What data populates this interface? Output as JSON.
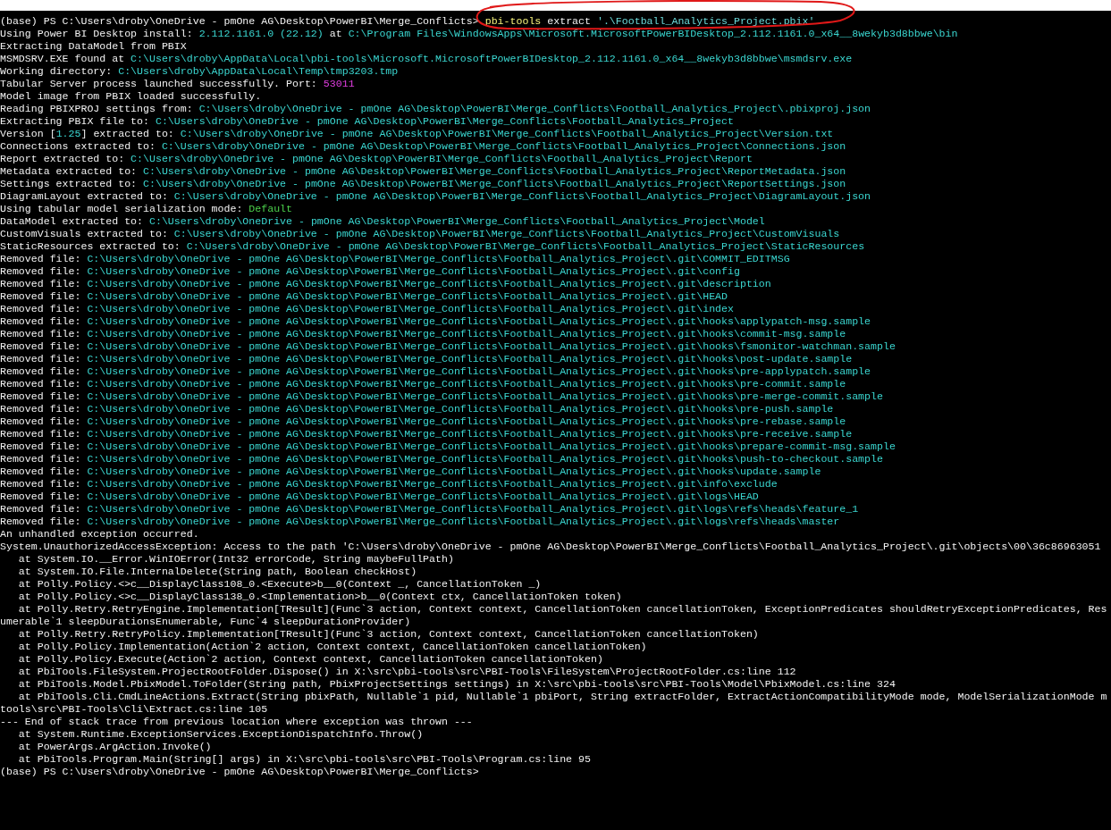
{
  "terminal": {
    "lines": [
      [
        {
          "kind": "plain",
          "text": "(base) PS C:\\Users\\droby\\OneDrive - pmOne AG\\Desktop\\PowerBI\\Merge_Conflicts> "
        },
        {
          "kind": "command",
          "text": "pbi-tools"
        },
        {
          "kind": "plain",
          "text": " extract "
        },
        {
          "kind": "string",
          "text": "'.\\Football_Analytics_Project.pbix'"
        }
      ],
      [
        {
          "kind": "plain",
          "text": "Using Power BI Desktop install: "
        },
        {
          "kind": "path",
          "text": "2.112.1161.0 (22.12)"
        },
        {
          "kind": "plain",
          "text": " at "
        },
        {
          "kind": "path",
          "text": "C:\\Program Files\\WindowsApps\\Microsoft.MicrosoftPowerBIDesktop_2.112.1161.0_x64__8wekyb3d8bbwe\\bin"
        }
      ],
      [
        {
          "kind": "plain",
          "text": "Extracting DataModel from PBIX"
        }
      ],
      [
        {
          "kind": "plain",
          "text": "MSMDSRV.EXE found at "
        },
        {
          "kind": "path",
          "text": "C:\\Users\\droby\\AppData\\Local\\pbi-tools\\Microsoft.MicrosoftPowerBIDesktop_2.112.1161.0_x64__8wekyb3d8bbwe\\msmdsrv.exe"
        }
      ],
      [
        {
          "kind": "plain",
          "text": "Working directory: "
        },
        {
          "kind": "path",
          "text": "C:\\Users\\droby\\AppData\\Local\\Temp\\tmp3203.tmp"
        }
      ],
      [
        {
          "kind": "plain",
          "text": "Tabular Server process launched successfully. Port: "
        },
        {
          "kind": "port",
          "text": "53011"
        }
      ],
      [
        {
          "kind": "plain",
          "text": "Model image from PBIX loaded successfully."
        }
      ],
      [
        {
          "kind": "plain",
          "text": "Reading PBIXPROJ settings from: "
        },
        {
          "kind": "path",
          "text": "C:\\Users\\droby\\OneDrive - pmOne AG\\Desktop\\PowerBI\\Merge_Conflicts\\Football_Analytics_Project\\.pbixproj.json"
        }
      ],
      [
        {
          "kind": "plain",
          "text": "Extracting PBIX file to: "
        },
        {
          "kind": "path",
          "text": "C:\\Users\\droby\\OneDrive - pmOne AG\\Desktop\\PowerBI\\Merge_Conflicts\\Football_Analytics_Project"
        }
      ],
      [
        {
          "kind": "plain",
          "text": "Version ["
        },
        {
          "kind": "path",
          "text": "1.25"
        },
        {
          "kind": "plain",
          "text": "] extracted to: "
        },
        {
          "kind": "path",
          "text": "C:\\Users\\droby\\OneDrive - pmOne AG\\Desktop\\PowerBI\\Merge_Conflicts\\Football_Analytics_Project\\Version.txt"
        }
      ],
      [
        {
          "kind": "plain",
          "text": "Connections extracted to: "
        },
        {
          "kind": "path",
          "text": "C:\\Users\\droby\\OneDrive - pmOne AG\\Desktop\\PowerBI\\Merge_Conflicts\\Football_Analytics_Project\\Connections.json"
        }
      ],
      [
        {
          "kind": "plain",
          "text": "Report extracted to: "
        },
        {
          "kind": "path",
          "text": "C:\\Users\\droby\\OneDrive - pmOne AG\\Desktop\\PowerBI\\Merge_Conflicts\\Football_Analytics_Project\\Report"
        }
      ],
      [
        {
          "kind": "plain",
          "text": "Metadata extracted to: "
        },
        {
          "kind": "path",
          "text": "C:\\Users\\droby\\OneDrive - pmOne AG\\Desktop\\PowerBI\\Merge_Conflicts\\Football_Analytics_Project\\ReportMetadata.json"
        }
      ],
      [
        {
          "kind": "plain",
          "text": "Settings extracted to: "
        },
        {
          "kind": "path",
          "text": "C:\\Users\\droby\\OneDrive - pmOne AG\\Desktop\\PowerBI\\Merge_Conflicts\\Football_Analytics_Project\\ReportSettings.json"
        }
      ],
      [
        {
          "kind": "plain",
          "text": "DiagramLayout extracted to: "
        },
        {
          "kind": "path",
          "text": "C:\\Users\\droby\\OneDrive - pmOne AG\\Desktop\\PowerBI\\Merge_Conflicts\\Football_Analytics_Project\\DiagramLayout.json"
        }
      ],
      [
        {
          "kind": "plain",
          "text": "Using tabular model serialization mode: "
        },
        {
          "kind": "value",
          "text": "Default"
        }
      ],
      [
        {
          "kind": "plain",
          "text": "DataModel extracted to: "
        },
        {
          "kind": "path",
          "text": "C:\\Users\\droby\\OneDrive - pmOne AG\\Desktop\\PowerBI\\Merge_Conflicts\\Football_Analytics_Project\\Model"
        }
      ],
      [
        {
          "kind": "plain",
          "text": "CustomVisuals extracted to: "
        },
        {
          "kind": "path",
          "text": "C:\\Users\\droby\\OneDrive - pmOne AG\\Desktop\\PowerBI\\Merge_Conflicts\\Football_Analytics_Project\\CustomVisuals"
        }
      ],
      [
        {
          "kind": "plain",
          "text": "StaticResources extracted to: "
        },
        {
          "kind": "path",
          "text": "C:\\Users\\droby\\OneDrive - pmOne AG\\Desktop\\PowerBI\\Merge_Conflicts\\Football_Analytics_Project\\StaticResources"
        }
      ],
      [
        {
          "kind": "plain",
          "text": "Removed file: "
        },
        {
          "kind": "path",
          "text": "C:\\Users\\droby\\OneDrive - pmOne AG\\Desktop\\PowerBI\\Merge_Conflicts\\Football_Analytics_Project\\.git\\COMMIT_EDITMSG"
        }
      ],
      [
        {
          "kind": "plain",
          "text": "Removed file: "
        },
        {
          "kind": "path",
          "text": "C:\\Users\\droby\\OneDrive - pmOne AG\\Desktop\\PowerBI\\Merge_Conflicts\\Football_Analytics_Project\\.git\\config"
        }
      ],
      [
        {
          "kind": "plain",
          "text": "Removed file: "
        },
        {
          "kind": "path",
          "text": "C:\\Users\\droby\\OneDrive - pmOne AG\\Desktop\\PowerBI\\Merge_Conflicts\\Football_Analytics_Project\\.git\\description"
        }
      ],
      [
        {
          "kind": "plain",
          "text": "Removed file: "
        },
        {
          "kind": "path",
          "text": "C:\\Users\\droby\\OneDrive - pmOne AG\\Desktop\\PowerBI\\Merge_Conflicts\\Football_Analytics_Project\\.git\\HEAD"
        }
      ],
      [
        {
          "kind": "plain",
          "text": "Removed file: "
        },
        {
          "kind": "path",
          "text": "C:\\Users\\droby\\OneDrive - pmOne AG\\Desktop\\PowerBI\\Merge_Conflicts\\Football_Analytics_Project\\.git\\index"
        }
      ],
      [
        {
          "kind": "plain",
          "text": "Removed file: "
        },
        {
          "kind": "path",
          "text": "C:\\Users\\droby\\OneDrive - pmOne AG\\Desktop\\PowerBI\\Merge_Conflicts\\Football_Analytics_Project\\.git\\hooks\\applypatch-msg.sample"
        }
      ],
      [
        {
          "kind": "plain",
          "text": "Removed file: "
        },
        {
          "kind": "path",
          "text": "C:\\Users\\droby\\OneDrive - pmOne AG\\Desktop\\PowerBI\\Merge_Conflicts\\Football_Analytics_Project\\.git\\hooks\\commit-msg.sample"
        }
      ],
      [
        {
          "kind": "plain",
          "text": "Removed file: "
        },
        {
          "kind": "path",
          "text": "C:\\Users\\droby\\OneDrive - pmOne AG\\Desktop\\PowerBI\\Merge_Conflicts\\Football_Analytics_Project\\.git\\hooks\\fsmonitor-watchman.sample"
        }
      ],
      [
        {
          "kind": "plain",
          "text": "Removed file: "
        },
        {
          "kind": "path",
          "text": "C:\\Users\\droby\\OneDrive - pmOne AG\\Desktop\\PowerBI\\Merge_Conflicts\\Football_Analytics_Project\\.git\\hooks\\post-update.sample"
        }
      ],
      [
        {
          "kind": "plain",
          "text": "Removed file: "
        },
        {
          "kind": "path",
          "text": "C:\\Users\\droby\\OneDrive - pmOne AG\\Desktop\\PowerBI\\Merge_Conflicts\\Football_Analytics_Project\\.git\\hooks\\pre-applypatch.sample"
        }
      ],
      [
        {
          "kind": "plain",
          "text": "Removed file: "
        },
        {
          "kind": "path",
          "text": "C:\\Users\\droby\\OneDrive - pmOne AG\\Desktop\\PowerBI\\Merge_Conflicts\\Football_Analytics_Project\\.git\\hooks\\pre-commit.sample"
        }
      ],
      [
        {
          "kind": "plain",
          "text": "Removed file: "
        },
        {
          "kind": "path",
          "text": "C:\\Users\\droby\\OneDrive - pmOne AG\\Desktop\\PowerBI\\Merge_Conflicts\\Football_Analytics_Project\\.git\\hooks\\pre-merge-commit.sample"
        }
      ],
      [
        {
          "kind": "plain",
          "text": "Removed file: "
        },
        {
          "kind": "path",
          "text": "C:\\Users\\droby\\OneDrive - pmOne AG\\Desktop\\PowerBI\\Merge_Conflicts\\Football_Analytics_Project\\.git\\hooks\\pre-push.sample"
        }
      ],
      [
        {
          "kind": "plain",
          "text": "Removed file: "
        },
        {
          "kind": "path",
          "text": "C:\\Users\\droby\\OneDrive - pmOne AG\\Desktop\\PowerBI\\Merge_Conflicts\\Football_Analytics_Project\\.git\\hooks\\pre-rebase.sample"
        }
      ],
      [
        {
          "kind": "plain",
          "text": "Removed file: "
        },
        {
          "kind": "path",
          "text": "C:\\Users\\droby\\OneDrive - pmOne AG\\Desktop\\PowerBI\\Merge_Conflicts\\Football_Analytics_Project\\.git\\hooks\\pre-receive.sample"
        }
      ],
      [
        {
          "kind": "plain",
          "text": "Removed file: "
        },
        {
          "kind": "path",
          "text": "C:\\Users\\droby\\OneDrive - pmOne AG\\Desktop\\PowerBI\\Merge_Conflicts\\Football_Analytics_Project\\.git\\hooks\\prepare-commit-msg.sample"
        }
      ],
      [
        {
          "kind": "plain",
          "text": "Removed file: "
        },
        {
          "kind": "path",
          "text": "C:\\Users\\droby\\OneDrive - pmOne AG\\Desktop\\PowerBI\\Merge_Conflicts\\Football_Analytics_Project\\.git\\hooks\\push-to-checkout.sample"
        }
      ],
      [
        {
          "kind": "plain",
          "text": "Removed file: "
        },
        {
          "kind": "path",
          "text": "C:\\Users\\droby\\OneDrive - pmOne AG\\Desktop\\PowerBI\\Merge_Conflicts\\Football_Analytics_Project\\.git\\hooks\\update.sample"
        }
      ],
      [
        {
          "kind": "plain",
          "text": "Removed file: "
        },
        {
          "kind": "path",
          "text": "C:\\Users\\droby\\OneDrive - pmOne AG\\Desktop\\PowerBI\\Merge_Conflicts\\Football_Analytics_Project\\.git\\info\\exclude"
        }
      ],
      [
        {
          "kind": "plain",
          "text": "Removed file: "
        },
        {
          "kind": "path",
          "text": "C:\\Users\\droby\\OneDrive - pmOne AG\\Desktop\\PowerBI\\Merge_Conflicts\\Football_Analytics_Project\\.git\\logs\\HEAD"
        }
      ],
      [
        {
          "kind": "plain",
          "text": "Removed file: "
        },
        {
          "kind": "path",
          "text": "C:\\Users\\droby\\OneDrive - pmOne AG\\Desktop\\PowerBI\\Merge_Conflicts\\Football_Analytics_Project\\.git\\logs\\refs\\heads\\feature_1"
        }
      ],
      [
        {
          "kind": "plain",
          "text": "Removed file: "
        },
        {
          "kind": "path",
          "text": "C:\\Users\\droby\\OneDrive - pmOne AG\\Desktop\\PowerBI\\Merge_Conflicts\\Football_Analytics_Project\\.git\\logs\\refs\\heads\\master"
        }
      ],
      [
        {
          "kind": "plain",
          "text": "An unhandled exception occurred."
        }
      ],
      [
        {
          "kind": "plain",
          "text": "System.UnauthorizedAccessException: Access to the path 'C:\\Users\\droby\\OneDrive - pmOne AG\\Desktop\\PowerBI\\Merge_Conflicts\\Football_Analytics_Project\\.git\\objects\\00\\36c86963051"
        }
      ],
      [
        {
          "kind": "plain",
          "text": "   at System.IO.__Error.WinIOError(Int32 errorCode, String maybeFullPath)"
        }
      ],
      [
        {
          "kind": "plain",
          "text": "   at System.IO.File.InternalDelete(String path, Boolean checkHost)"
        }
      ],
      [
        {
          "kind": "plain",
          "text": "   at Polly.Policy.<>c__DisplayClass108_0.<Execute>b__0(Context _, CancellationToken _)"
        }
      ],
      [
        {
          "kind": "plain",
          "text": "   at Polly.Policy.<>c__DisplayClass138_0.<Implementation>b__0(Context ctx, CancellationToken token)"
        }
      ],
      [
        {
          "kind": "plain",
          "text": "   at Polly.Retry.RetryEngine.Implementation[TResult](Func`3 action, Context context, CancellationToken cancellationToken, ExceptionPredicates shouldRetryExceptionPredicates, Res"
        }
      ],
      [
        {
          "kind": "plain",
          "text": "umerable`1 sleepDurationsEnumerable, Func`4 sleepDurationProvider)"
        }
      ],
      [
        {
          "kind": "plain",
          "text": "   at Polly.Retry.RetryPolicy.Implementation[TResult](Func`3 action, Context context, CancellationToken cancellationToken)"
        }
      ],
      [
        {
          "kind": "plain",
          "text": "   at Polly.Policy.Implementation(Action`2 action, Context context, CancellationToken cancellationToken)"
        }
      ],
      [
        {
          "kind": "plain",
          "text": "   at Polly.Policy.Execute(Action`2 action, Context context, CancellationToken cancellationToken)"
        }
      ],
      [
        {
          "kind": "plain",
          "text": "   at PbiTools.FileSystem.ProjectRootFolder.Dispose() in X:\\src\\pbi-tools\\src\\PBI-Tools\\FileSystem\\ProjectRootFolder.cs:line 112"
        }
      ],
      [
        {
          "kind": "plain",
          "text": "   at PbiTools.Model.PbixModel.ToFolder(String path, PbixProjectSettings settings) in X:\\src\\pbi-tools\\src\\PBI-Tools\\Model\\PbixModel.cs:line 324"
        }
      ],
      [
        {
          "kind": "plain",
          "text": "   at PbiTools.Cli.CmdLineActions.Extract(String pbixPath, Nullable`1 pid, Nullable`1 pbiPort, String extractFolder, ExtractActionCompatibilityMode mode, ModelSerializationMode m"
        }
      ],
      [
        {
          "kind": "plain",
          "text": "tools\\src\\PBI-Tools\\Cli\\Extract.cs:line 105"
        }
      ],
      [
        {
          "kind": "plain",
          "text": "--- End of stack trace from previous location where exception was thrown ---"
        }
      ],
      [
        {
          "kind": "plain",
          "text": "   at System.Runtime.ExceptionServices.ExceptionDispatchInfo.Throw()"
        }
      ],
      [
        {
          "kind": "plain",
          "text": "   at PowerArgs.ArgAction.Invoke()"
        }
      ],
      [
        {
          "kind": "plain",
          "text": "   at PbiTools.Program.Main(String[] args) in X:\\src\\pbi-tools\\src\\PBI-Tools\\Program.cs:line 95"
        }
      ],
      [
        {
          "kind": "plain",
          "text": "(base) PS C:\\Users\\droby\\OneDrive - pmOne AG\\Desktop\\PowerBI\\Merge_Conflicts>"
        }
      ]
    ]
  }
}
